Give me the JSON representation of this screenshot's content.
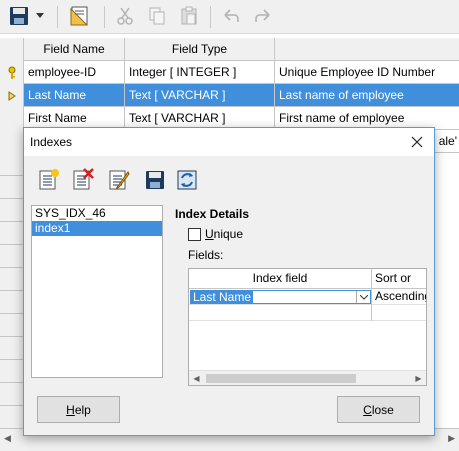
{
  "toolbar": {
    "items": [
      {
        "name": "save",
        "icon": "save-icon"
      },
      {
        "name": "save-dropdown",
        "icon": "chevron-down-icon"
      },
      {
        "name": "index-design",
        "icon": "index-design-icon"
      },
      {
        "name": "cut",
        "icon": "cut-icon"
      },
      {
        "name": "copy",
        "icon": "copy-icon"
      },
      {
        "name": "paste",
        "icon": "paste-icon"
      },
      {
        "name": "undo",
        "icon": "undo-icon"
      },
      {
        "name": "redo",
        "icon": "redo-icon"
      }
    ]
  },
  "table": {
    "headers": [
      "Field Name",
      "Field Type",
      ""
    ],
    "rows": [
      {
        "name": "employee-ID",
        "type": "Integer [ INTEGER ]",
        "desc": "Unique Employee ID Number",
        "marker": "primary-key-icon"
      },
      {
        "name": "Last Name",
        "type": "Text [ VARCHAR ]",
        "desc": "Last name of employee",
        "marker": "current-row-arrow-icon"
      },
      {
        "name": "First Name",
        "type": "Text [ VARCHAR ]",
        "desc": "First name of employee"
      },
      {
        "name": "",
        "type": "",
        "desc": "ale'"
      }
    ]
  },
  "dialog": {
    "title": "Indexes",
    "toolbar": [
      {
        "name": "new-index",
        "icon": "new-index-icon"
      },
      {
        "name": "delete-index",
        "icon": "delete-index-icon"
      },
      {
        "name": "rename-index",
        "icon": "rename-index-icon"
      },
      {
        "name": "save-index",
        "icon": "save-index-icon"
      },
      {
        "name": "reset-index",
        "icon": "reset-index-icon"
      }
    ],
    "index_list": [
      "SYS_IDX_46",
      "index1"
    ],
    "selected_index": "index1",
    "details_title": "Index Details",
    "unique_label": "Unique",
    "unique_checked": false,
    "fields_label": "Fields:",
    "fields_table": {
      "headers": [
        "Index field",
        "Sort or"
      ],
      "rows": [
        {
          "field": "Last Name",
          "sort": "Ascending"
        }
      ]
    },
    "help_label": "Help",
    "close_label": "Close"
  },
  "colors": {
    "selection": "#3f8fdc",
    "dialog_border": "#5b9bd5",
    "toolbar_bg": "#f0f0f0"
  }
}
